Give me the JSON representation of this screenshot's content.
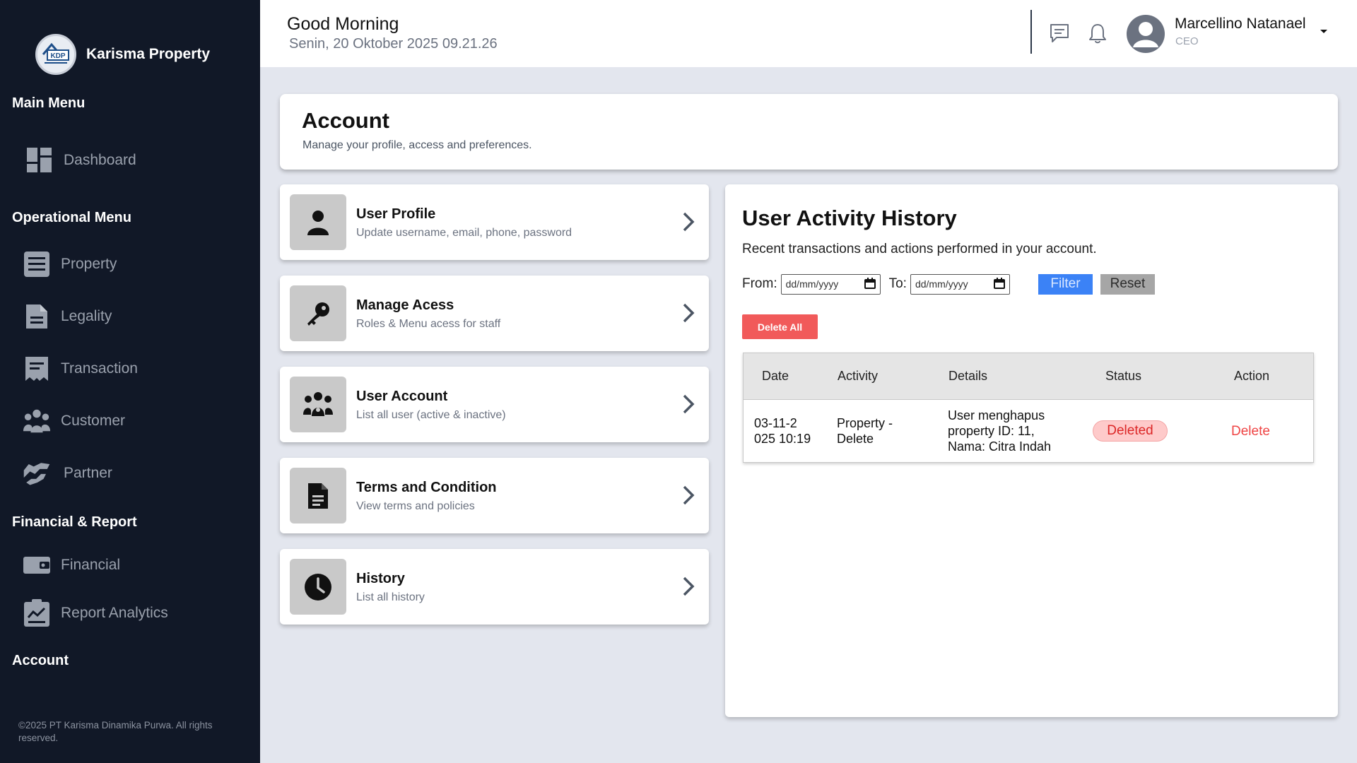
{
  "brand": {
    "name": "Karisma Property",
    "logo_text": "KDP"
  },
  "sidebar": {
    "sections": {
      "main": "Main Menu",
      "operational": "Operational Menu",
      "financial": "Financial & Report",
      "account": "Account"
    },
    "items": {
      "dashboard": "Dashboard",
      "property": "Property",
      "legality": "Legality",
      "transaction": "Transaction",
      "customer": "Customer",
      "partner": "Partner",
      "financial": "Financial",
      "report": "Report Analytics"
    },
    "copyright": "©2025 PT Karisma Dinamika Purwa. All rights reserved."
  },
  "header": {
    "greeting": "Good Morning",
    "datetime": "Senin, 20 Oktober 2025 09.21.26",
    "user_name": "Marcellino Natanael",
    "user_role": "CEO"
  },
  "account": {
    "title": "Account",
    "subtitle": "Manage your profile, access and preferences."
  },
  "menu": [
    {
      "title": "User Profile",
      "subtitle": "Update username, email, phone, password",
      "icon": "user-icon"
    },
    {
      "title": "Manage Acess",
      "subtitle": "Roles & Menu acess for staff",
      "icon": "key-icon"
    },
    {
      "title": "User Account",
      "subtitle": "List all user (active & inactive)",
      "icon": "users-icon"
    },
    {
      "title": "Terms and Condition",
      "subtitle": "View terms and policies",
      "icon": "document-icon"
    },
    {
      "title": "History",
      "subtitle": "List all history",
      "icon": "clock-icon"
    }
  ],
  "activity": {
    "title": "User Activity History",
    "subtitle": "Recent transactions and actions performed in your account.",
    "from_label": "From:",
    "to_label": "To:",
    "date_placeholder": "dd/mm/yyyy",
    "filter_label": "Filter",
    "reset_label": "Reset",
    "delete_all_label": "Delete All",
    "columns": [
      "Date",
      "Activity",
      "Details",
      "Status",
      "Action"
    ],
    "rows": [
      {
        "date_line1": "03-11-2",
        "date_line2": "025 10:19",
        "activity_line1": "Property -",
        "activity_line2": "Delete",
        "details_line1": "User menghapus",
        "details_line2": "property ID: 11,",
        "details_line3": "Nama: Citra Indah",
        "status": "Deleted",
        "action": "Delete"
      }
    ]
  },
  "colors": {
    "sidebar_bg": "#111827",
    "primary_blue": "#3b82f6",
    "danger_red": "#f15a5a",
    "status_bg": "#fecaca"
  }
}
